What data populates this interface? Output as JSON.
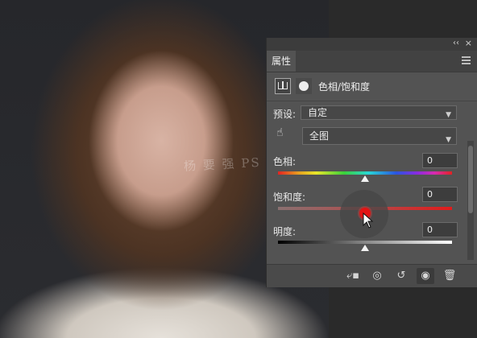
{
  "watermark": "杨 要 强 PS 教 程",
  "panel": {
    "tab_label": "属性",
    "collapse_glyph": "‹‹",
    "close_glyph": "×",
    "title": "色相/饱和度",
    "preset_label": "预设:",
    "preset_value": "自定",
    "channel_value": "全图",
    "hue": {
      "label": "色相:",
      "value": "0",
      "level": 0.5
    },
    "saturation": {
      "label": "饱和度:",
      "value": "0",
      "level": 0.5
    },
    "lightness": {
      "label": "明度:",
      "value": "0",
      "level": 0.5
    }
  },
  "bottom_icons": [
    "clip-to-layer-icon",
    "view-previous-icon",
    "reset-icon",
    "visibility-eye-icon",
    "delete-icon"
  ]
}
